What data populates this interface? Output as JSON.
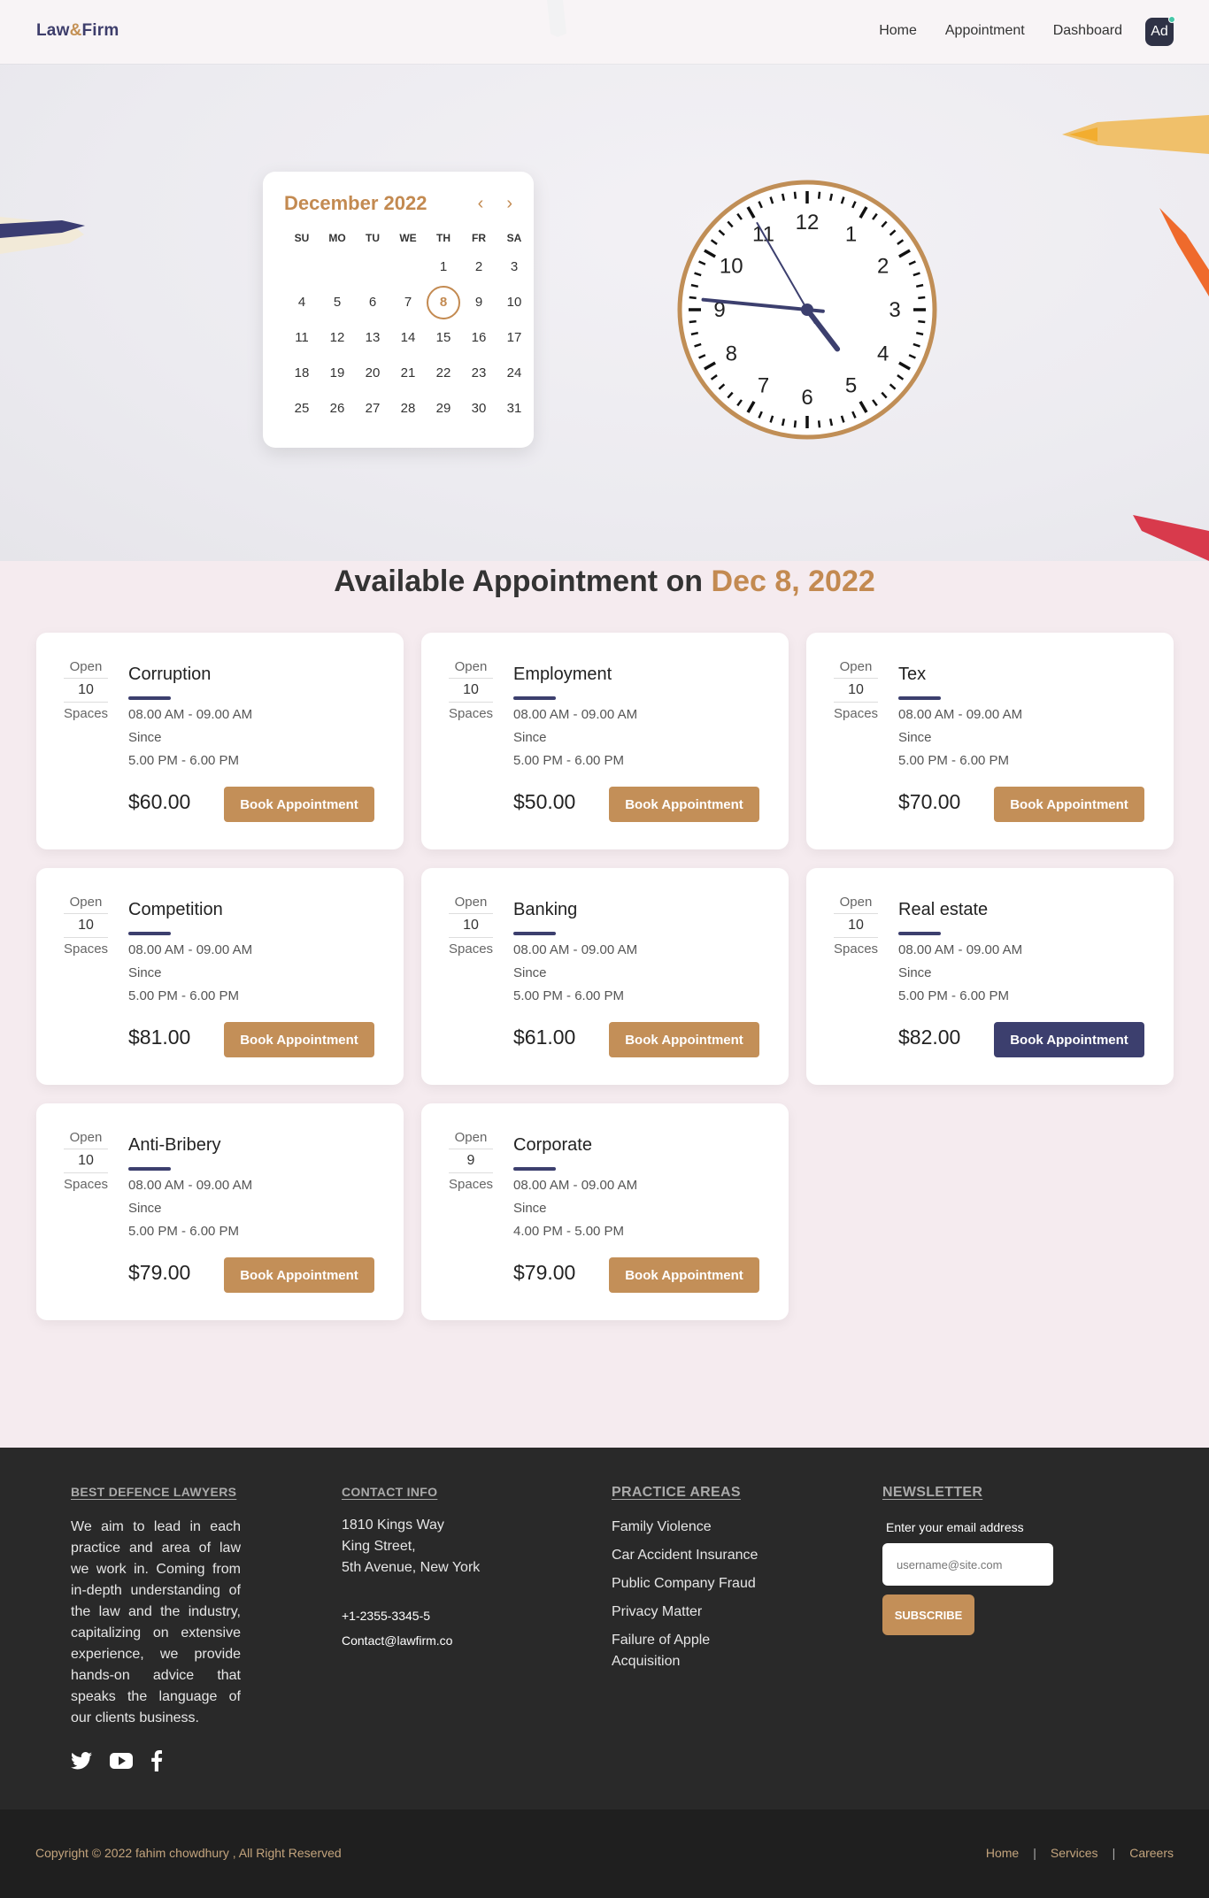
{
  "nav": {
    "brand_left": "Law",
    "brand_amp": "&",
    "brand_right": "Firm",
    "links": [
      "Home",
      "Appointment",
      "Dashboard"
    ],
    "avatar": "Ad"
  },
  "calendar": {
    "month": "December 2022",
    "prev_icon": "‹",
    "next_icon": "›",
    "day_names": [
      "SU",
      "MO",
      "TU",
      "WE",
      "TH",
      "FR",
      "SA"
    ],
    "first_weekday": 4,
    "days_in_month": 31,
    "selected_day": 8
  },
  "clock": {
    "numerals": [
      "12",
      "1",
      "2",
      "3",
      "4",
      "5",
      "6",
      "7",
      "8",
      "9",
      "10",
      "11"
    ],
    "hour": 4,
    "minute": 45,
    "second": 55
  },
  "section": {
    "title": "Available Appointment on",
    "date": "Dec 8, 2022"
  },
  "cards": [
    {
      "open_label": "Open",
      "spaces": "10",
      "spaces_label": "Spaces",
      "title": "Corruption",
      "time1": "08.00 AM - 09.00 AM",
      "since": "Since",
      "time2": "5.00 PM - 6.00 PM",
      "price": "$60.00",
      "button": "Book Appointment",
      "active": false
    },
    {
      "open_label": "Open",
      "spaces": "10",
      "spaces_label": "Spaces",
      "title": "Employment",
      "time1": "08.00 AM - 09.00 AM",
      "since": "Since",
      "time2": "5.00 PM - 6.00 PM",
      "price": "$50.00",
      "button": "Book Appointment",
      "active": false
    },
    {
      "open_label": "Open",
      "spaces": "10",
      "spaces_label": "Spaces",
      "title": "Tex",
      "time1": "08.00 AM - 09.00 AM",
      "since": "Since",
      "time2": "5.00 PM - 6.00 PM",
      "price": "$70.00",
      "button": "Book Appointment",
      "active": false
    },
    {
      "open_label": "Open",
      "spaces": "10",
      "spaces_label": "Spaces",
      "title": "Competition",
      "time1": "08.00 AM - 09.00 AM",
      "since": "Since",
      "time2": "5.00 PM - 6.00 PM",
      "price": "$81.00",
      "button": "Book Appointment",
      "active": false
    },
    {
      "open_label": "Open",
      "spaces": "10",
      "spaces_label": "Spaces",
      "title": "Banking",
      "time1": "08.00 AM - 09.00 AM",
      "since": "Since",
      "time2": "5.00 PM - 6.00 PM",
      "price": "$61.00",
      "button": "Book Appointment",
      "active": false
    },
    {
      "open_label": "Open",
      "spaces": "10",
      "spaces_label": "Spaces",
      "title": "Real estate",
      "time1": "08.00 AM - 09.00 AM",
      "since": "Since",
      "time2": "5.00 PM - 6.00 PM",
      "price": "$82.00",
      "button": "Book Appointment",
      "active": true
    },
    {
      "open_label": "Open",
      "spaces": "10",
      "spaces_label": "Spaces",
      "title": "Anti-Bribery",
      "time1": "08.00 AM - 09.00 AM",
      "since": "Since",
      "time2": "5.00 PM - 6.00 PM",
      "price": "$79.00",
      "button": "Book Appointment",
      "active": false
    },
    {
      "open_label": "Open",
      "spaces": "9",
      "spaces_label": "Spaces",
      "title": "Corporate",
      "time1": "08.00 AM - 09.00 AM",
      "since": "Since",
      "time2": "4.00 PM - 5.00 PM",
      "price": "$79.00",
      "button": "Book Appointment",
      "active": false
    }
  ],
  "footer": {
    "about_heading": "BEST DEFENCE LAWYERS",
    "about_text": "We aim to lead in each practice and area of law we work in. Coming from in-depth understanding of the law and the industry, capitalizing on extensive experience, we provide hands-on advice that speaks the language of our clients business.",
    "contact_heading": "CONTACT INFO",
    "address1": "1810 Kings Way",
    "address2": "King Street,",
    "address3": "5th Avenue, New York",
    "phone": "+1-2355-3345-5",
    "email": "Contact@lawfirm.co",
    "practice_heading": "PRACTICE AREAS",
    "practice": [
      "Family Violence",
      "Car Accident Insurance",
      "Public Company Fraud",
      "Privacy Matter",
      "Failure of Apple Acquisition"
    ],
    "newsletter_heading": "NEWSLETTER",
    "newsletter_label": "Enter your email address",
    "email_placeholder": "username@site.com",
    "subscribe": "SUBSCRIBE",
    "social_icons": [
      "twitter-icon",
      "youtube-icon",
      "facebook-icon"
    ]
  },
  "bottom": {
    "copyright": "Copyright © 2022 fahim chowdhury , All Right Reserved",
    "links": [
      "Home",
      "Services",
      "Careers"
    ],
    "separator": "|"
  },
  "colors": {
    "accent": "#c38a51",
    "navy": "#3c3f6e",
    "footer_bg": "#292929",
    "page_bg": "#f5ebef"
  }
}
